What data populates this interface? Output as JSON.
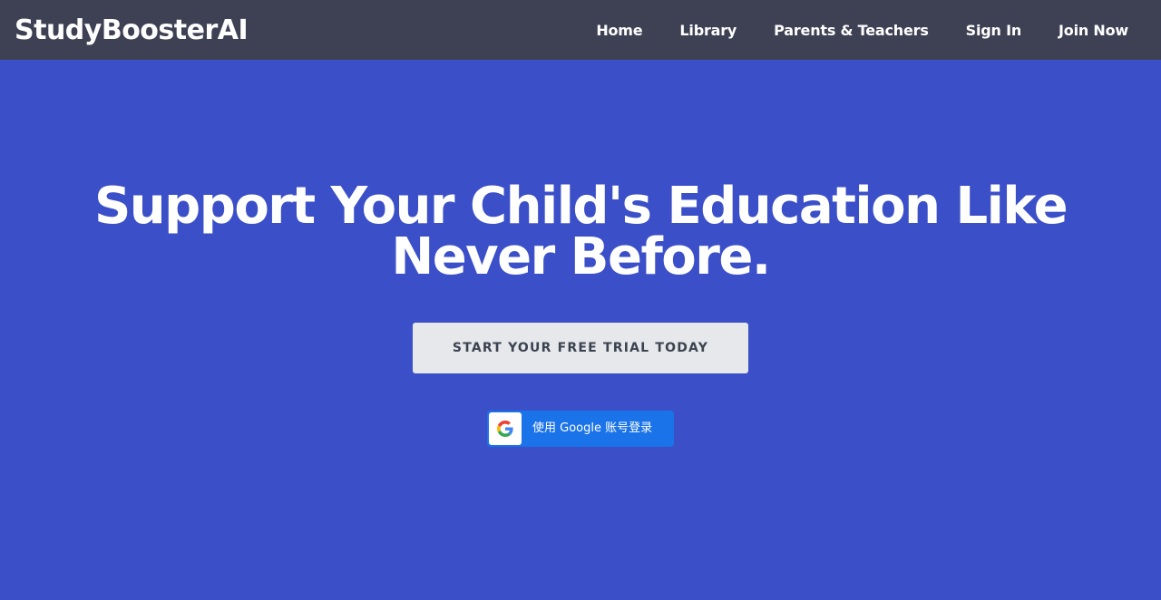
{
  "navbar": {
    "brand": "StudyBoosterAI",
    "links": [
      {
        "label": "Home"
      },
      {
        "label": "Library"
      },
      {
        "label": "Parents & Teachers"
      },
      {
        "label": "Sign In"
      },
      {
        "label": "Join Now"
      }
    ],
    "background_color": "#3e4154"
  },
  "hero": {
    "headline": "Support Your Child's Education Like Never Before.",
    "cta_label": "START YOUR FREE TRIAL TODAY",
    "google_signin_label": "使用 Google 账号登录",
    "google_icon": "google-g-icon",
    "background_color": "#3b4fc9",
    "google_button_color": "#1a73e8"
  }
}
